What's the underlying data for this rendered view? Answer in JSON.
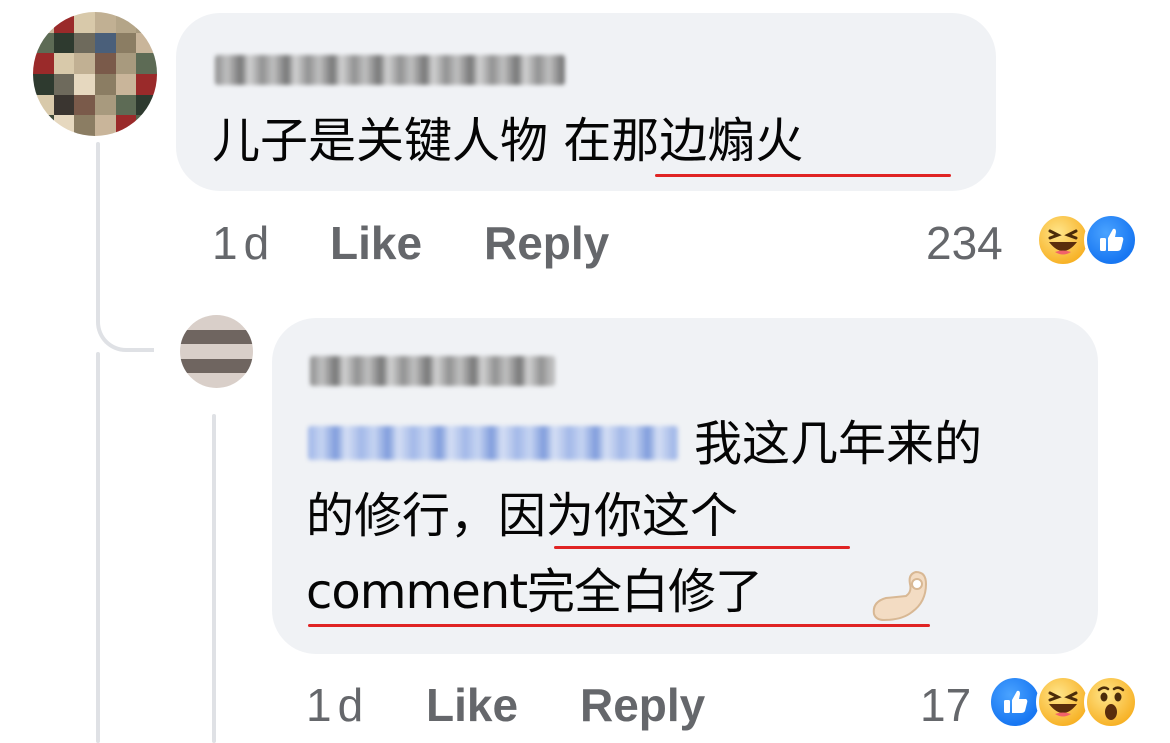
{
  "comment": {
    "text_part1": "儿子是关键人物 ",
    "text_part2": "在那边煽火",
    "meta": {
      "time": "1d",
      "like_label": "Like",
      "reply_label": "Reply"
    },
    "reaction_count": "234",
    "reactions": [
      "haha-icon",
      "like-icon"
    ]
  },
  "reply": {
    "line1": "我这几年来的",
    "line2a": "的修行，",
    "line2b": "因为你这个",
    "line3": "comment完全白修了",
    "trailing_emoji": "ok-hand-emoji",
    "meta": {
      "time": "1d",
      "like_label": "Like",
      "reply_label": "Reply"
    },
    "reaction_count": "17",
    "reactions": [
      "like-icon",
      "haha-icon",
      "wow-icon"
    ]
  },
  "colors": {
    "bubble_bg": "#f0f2f5",
    "meta_text": "#65676b",
    "underline": "#e02424",
    "like_blue": "#1877f2",
    "emoji_yellow": "#f7b125",
    "thread_line": "#dfe1e5"
  }
}
